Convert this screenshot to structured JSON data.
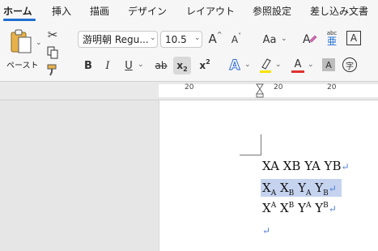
{
  "tabs": [
    {
      "label": "ホーム",
      "active": true
    },
    {
      "label": "挿入"
    },
    {
      "label": "描画"
    },
    {
      "label": "デザイン"
    },
    {
      "label": "レイアウト"
    },
    {
      "label": "参照設定"
    },
    {
      "label": "差し込み文書"
    }
  ],
  "ribbon": {
    "paste_label": "ペースト",
    "font_name": "游明朝 Regu...",
    "font_size": "10.5",
    "grow_font": "A",
    "shrink_font": "A",
    "change_case": "Aa",
    "ruby_label": "abc",
    "ruby_kanji": "亜",
    "enclose_char": "A",
    "bold": "B",
    "italic": "I",
    "underline": "U",
    "strike": "ab",
    "subscript": "x",
    "subscript_mark": "2",
    "superscript": "x",
    "superscript_mark": "2",
    "text_effects": "A",
    "font_color": "A",
    "char_shading": "A",
    "enclose_circle": "字",
    "colors": {
      "accent": "#1f6fd1",
      "highlight": "#f4e300",
      "font_color": "#e03030"
    }
  },
  "ruler": {
    "left_number": "20",
    "mid_number": "20",
    "right_number": "20"
  },
  "document": {
    "line1": {
      "t1": "XA XB YA YB"
    },
    "line2": {
      "a": "X",
      "a_sub": "A",
      "b": "X",
      "b_sub": "B",
      "c": "Y",
      "c_sub": "A",
      "d": "Y",
      "d_sub": "B"
    },
    "line3": {
      "a": "X",
      "a_sup": "A",
      "b": "X",
      "b_sup": "B",
      "c": "Y",
      "c_sup": "A",
      "d": "Y",
      "d_sup": "B"
    },
    "paragraph_mark": "↵",
    "selection_color": "#c5d3ef"
  }
}
